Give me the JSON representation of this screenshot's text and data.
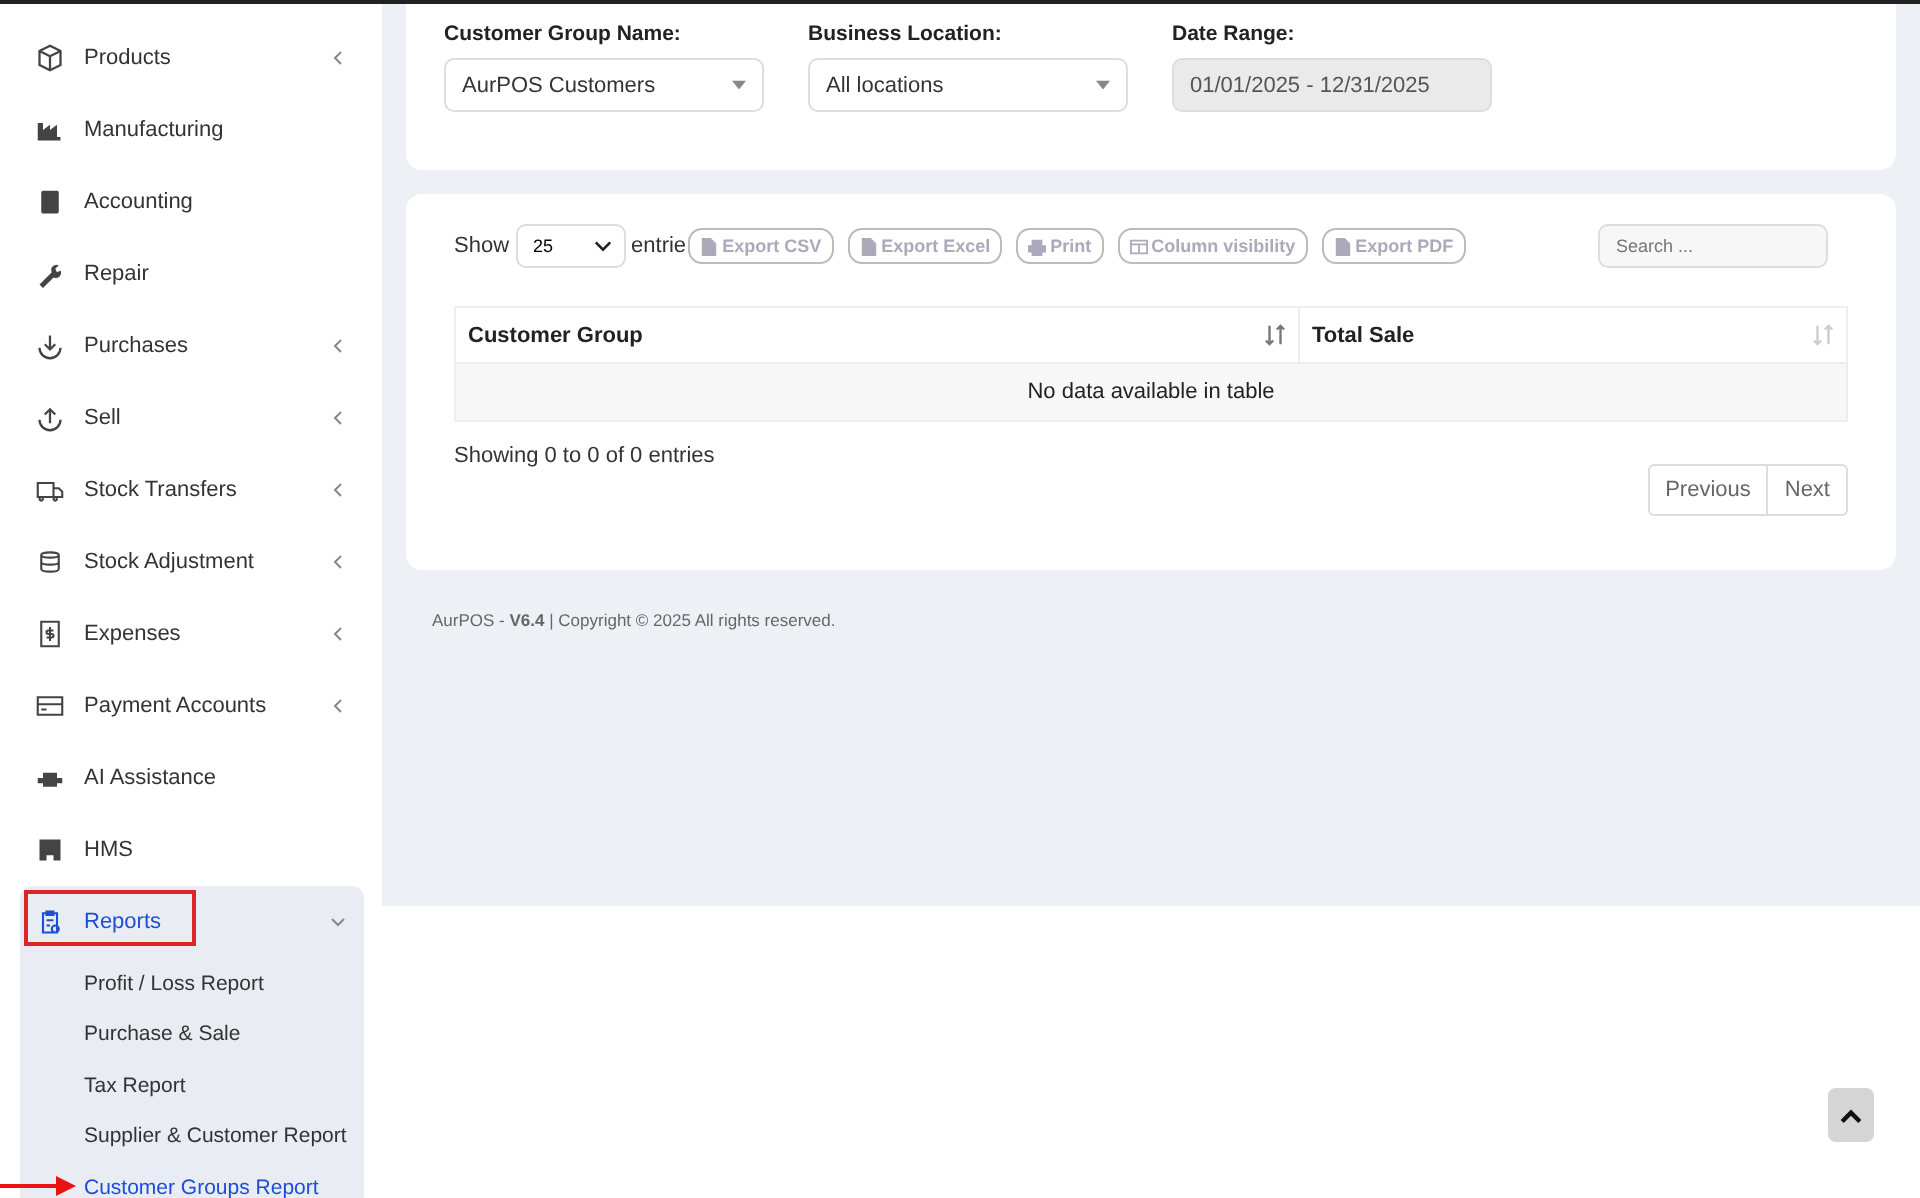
{
  "sidebar": {
    "items": [
      {
        "label": "Products",
        "expandable": true,
        "expanded": false,
        "highlighted": false
      },
      {
        "label": "Manufacturing",
        "expandable": false,
        "expanded": false,
        "highlighted": false
      },
      {
        "label": "Accounting",
        "expandable": false,
        "expanded": false,
        "highlighted": false
      },
      {
        "label": "Repair",
        "expandable": false,
        "expanded": false,
        "highlighted": false
      },
      {
        "label": "Purchases",
        "expandable": true,
        "expanded": false,
        "highlighted": false
      },
      {
        "label": "Sell",
        "expandable": true,
        "expanded": false,
        "highlighted": false
      },
      {
        "label": "Stock Transfers",
        "expandable": true,
        "expanded": false,
        "highlighted": false
      },
      {
        "label": "Stock Adjustment",
        "expandable": true,
        "expanded": false,
        "highlighted": false
      },
      {
        "label": "Expenses",
        "expandable": true,
        "expanded": false,
        "highlighted": false
      },
      {
        "label": "Payment Accounts",
        "expandable": true,
        "expanded": false,
        "highlighted": false
      },
      {
        "label": "AI Assistance",
        "expandable": false,
        "expanded": false,
        "highlighted": false
      },
      {
        "label": "HMS",
        "expandable": false,
        "expanded": false,
        "highlighted": false
      },
      {
        "label": "Reports",
        "expandable": true,
        "expanded": true,
        "highlighted": true,
        "children": [
          {
            "label": "Profit / Loss Report",
            "selected": false,
            "pointed": false
          },
          {
            "label": "Purchase & Sale",
            "selected": false,
            "pointed": false
          },
          {
            "label": "Tax Report",
            "selected": false,
            "pointed": false
          },
          {
            "label": "Supplier & Customer Report",
            "selected": false,
            "pointed": false
          },
          {
            "label": "Customer Groups Report",
            "selected": true,
            "pointed": true
          }
        ]
      }
    ]
  },
  "filters": [
    {
      "label": "Customer Group Name:",
      "value": "AurPOS Customers",
      "kind": "dropdown"
    },
    {
      "label": "Business Location:",
      "value": "All locations",
      "kind": "dropdown"
    },
    {
      "label": "Date Range:",
      "value": "01/01/2025 - 12/31/2025",
      "kind": "readonly"
    }
  ],
  "table_controls": {
    "show_label": "Show",
    "page_size": "25",
    "entries_label": "entrie",
    "buttons": [
      "Export CSV",
      "Export Excel",
      "Print",
      "Column visibility",
      "Export PDF"
    ],
    "search": {
      "placeholder": "Search ..."
    }
  },
  "table": {
    "columns": [
      "Customer Group",
      "Total Sale"
    ],
    "empty_message": "No data available in table"
  },
  "info": "Showing 0 to 0 of 0 entries",
  "pagination": [
    "Previous",
    "Next"
  ],
  "footer": {
    "brand": "AurPOS - ",
    "version": "V6.4",
    "copyright": " | Copyright © 2025 All rights reserved."
  }
}
